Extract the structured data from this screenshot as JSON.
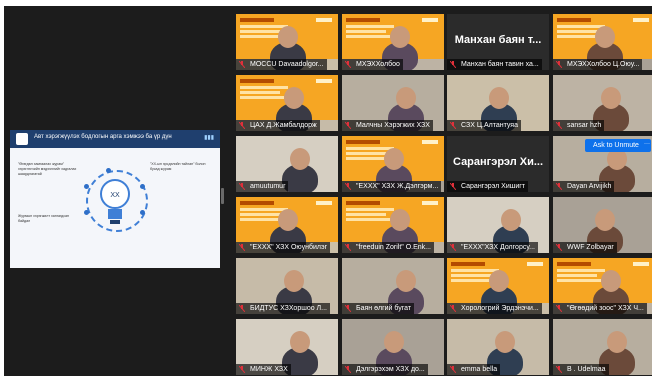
{
  "meeting": {
    "shared_screen": {
      "title": "Авт хэрэгжүүлэх бодлогын арга хэмжээ ба үр дүн",
      "center_label": "ХХ",
      "left_text": "\"Өгөгдөл хамгаалах журам\" хэрэглэгчийн мэдээллийг хадгалах шаардлагатай",
      "right_text": "\"ХХ-ын эрсдэлийн тайлан\" болон бусад журам",
      "bottom_text": "Журмын хэрэгжилт хангагдсан байдал"
    },
    "ask_to_unmute": "Ask to Unmute",
    "more": "···",
    "participants": [
      {
        "name": "MOCCU Davaadolgor..."
      },
      {
        "name": "МХЭХХолбоо"
      },
      {
        "name": "Манхан баян тавин ха...",
        "big": "Манхан баян т..."
      },
      {
        "name": "МХЭХХолбоо Ц.Оюу..."
      },
      {
        "name": "ЦАХ Д.Жамбалдорж"
      },
      {
        "name": "Малчны Хэрэгжих ХЗХ"
      },
      {
        "name": "СЗХ Ц.Алтантуяа"
      },
      {
        "name": "sansar hzh"
      },
      {
        "name": "amuutumur"
      },
      {
        "name": "\"ЕХХХ\" ХЗХ Ж.Дэлгэрм..."
      },
      {
        "name": "Сарангэрэл Хишигт",
        "big": "Сарангэрэл Хи..."
      },
      {
        "name": "Dayan Arvijikh",
        "big": "Dayan Arvijikh"
      },
      {
        "name": "\"ЕХХХ\" ХЗХ Оюунбилэг"
      },
      {
        "name": "\"freeduin Zorilt\" O.Enk..."
      },
      {
        "name": "\"ЕХХХ\"ХЗХ Долгорсу..."
      },
      {
        "name": "WWF Zolbayar"
      },
      {
        "name": "БИДТУС ХЗХоршоо Л..."
      },
      {
        "name": "Баян өлгий бугат"
      },
      {
        "name": "Хорологрий Эрдэнэчи..."
      },
      {
        "name": "\"Өгөөдий зоос\" ХЗХ Ч..."
      },
      {
        "name": "МИНЖ ХЗХ"
      },
      {
        "name": "Дэлгэрэхэм ХЗХ до..."
      },
      {
        "name": "emma bella"
      },
      {
        "name": "B . Udelmaa"
      }
    ]
  },
  "colors": {
    "background": "#1c1c1c",
    "slide_orange": "#f6a623",
    "accent_blue": "#0e71eb",
    "mic_red": "#e0303a"
  },
  "icons": {
    "muted_mic": "mic-muted-icon"
  }
}
